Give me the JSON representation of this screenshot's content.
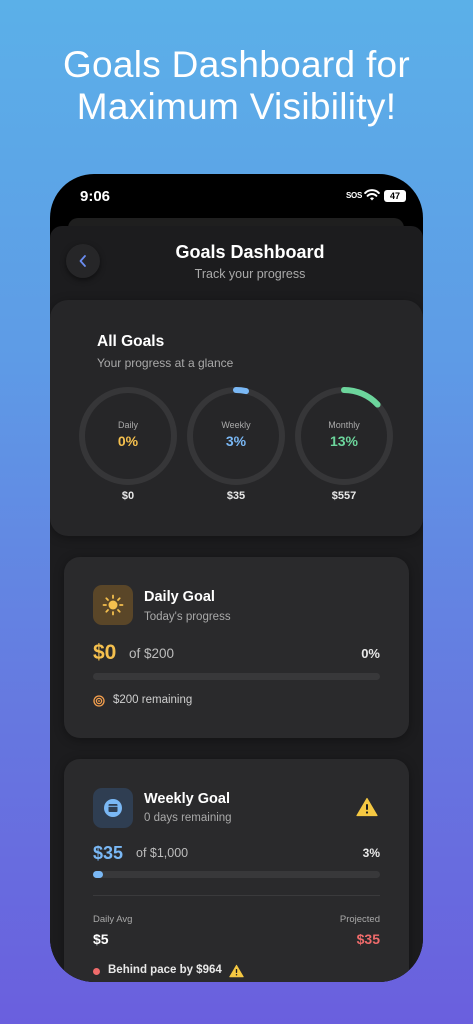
{
  "headline": "Goals Dashboard for Maximum Visibility!",
  "status_bar": {
    "time": "9:06",
    "sos": "SOS",
    "battery": "47"
  },
  "header": {
    "title": "Goals Dashboard",
    "subtitle": "Track your progress",
    "back_icon": "chevron-left-icon"
  },
  "all_goals": {
    "title": "All Goals",
    "subtitle": "Your progress at a glance",
    "rings": [
      {
        "label": "Daily",
        "percent_text": "0%",
        "progress": 0,
        "amount": "$0",
        "color": "#f5c04e"
      },
      {
        "label": "Weekly",
        "percent_text": "3%",
        "progress": 0.035,
        "amount": "$35",
        "color": "#7ab8f5"
      },
      {
        "label": "Monthly",
        "percent_text": "13%",
        "progress": 0.13,
        "amount": "$557",
        "color": "#6cd59c"
      }
    ]
  },
  "daily_goal": {
    "title": "Daily Goal",
    "subtitle": "Today's progress",
    "icon": "sun-icon",
    "amount": "$0",
    "of_target": "of $200",
    "percent": "0%",
    "progress": 0,
    "remaining": "$200 remaining",
    "accent": "#f5c04e"
  },
  "weekly_goal": {
    "title": "Weekly Goal",
    "subtitle": "0 days remaining",
    "icon": "calendar-icon",
    "warning_icon": "warning-icon",
    "amount": "$35",
    "of_target": "of $1,000",
    "percent": "3%",
    "progress": 0.035,
    "daily_avg_label": "Daily Avg",
    "daily_avg_value": "$5",
    "projected_label": "Projected",
    "projected_value": "$35",
    "pace_text": "Behind pace by $964",
    "accent": "#7ab8f5",
    "alert_color": "#ef6b6b"
  }
}
